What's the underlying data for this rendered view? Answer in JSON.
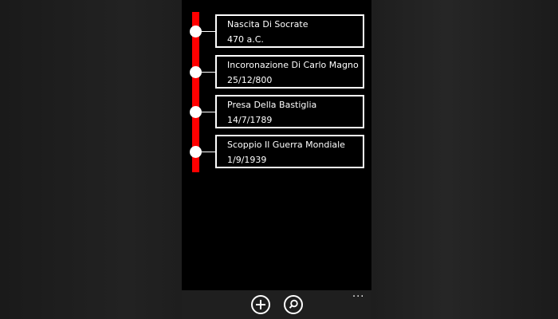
{
  "timeline": {
    "events": [
      {
        "title": "Nascita Di Socrate",
        "date": "470 a.C."
      },
      {
        "title": "Incoronazione Di Carlo Magno",
        "date": "25/12/800"
      },
      {
        "title": "Presa Della Bastiglia",
        "date": "14/7/1789"
      },
      {
        "title": "Scoppio Il Guerra Mondiale",
        "date": "1/9/1939"
      }
    ]
  },
  "appbar": {
    "buttons": [
      {
        "icon": "add-icon"
      },
      {
        "icon": "search-icon"
      }
    ],
    "more_label": "..."
  },
  "colors": {
    "accent": "#ff0000",
    "background": "#000000",
    "foreground": "#ffffff",
    "appbar": "#1f1f1f"
  }
}
